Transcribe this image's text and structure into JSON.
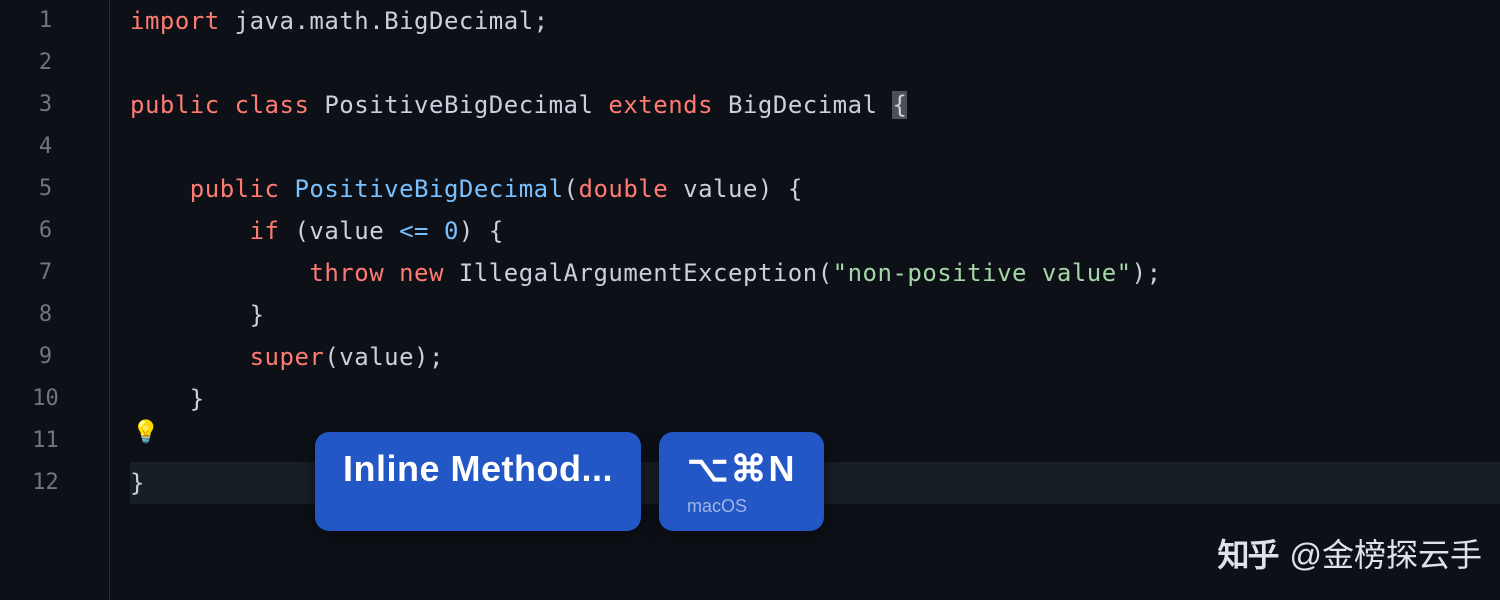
{
  "gutter": {
    "lines": [
      "1",
      "2",
      "3",
      "4",
      "5",
      "6",
      "7",
      "8",
      "9",
      "10",
      "11",
      "12"
    ]
  },
  "code": {
    "l1": {
      "kw_import": "import",
      "pkg": "java.math.BigDecimal",
      "semi": ";"
    },
    "l3": {
      "kw_public": "public",
      "kw_class": "class",
      "name": "PositiveBigDecimal",
      "kw_extends": "extends",
      "supertype": "BigDecimal",
      "brace": "{"
    },
    "l5": {
      "kw_public": "public",
      "ctor": "PositiveBigDecimal",
      "lp": "(",
      "ptype": "double",
      "pname": "value",
      "rp": ")",
      "brace": "{"
    },
    "l6": {
      "kw_if": "if",
      "lp": "(",
      "var": "value",
      "op": "<=",
      "zero": "0",
      "rp": ")",
      "brace": "{"
    },
    "l7": {
      "kw_throw": "throw",
      "kw_new": "new",
      "ex": "IllegalArgumentException",
      "lp": "(",
      "str": "\"non-positive value\"",
      "rp": ")",
      "semi": ";"
    },
    "l8": {
      "brace": "}"
    },
    "l9": {
      "kw_super": "super",
      "lp": "(",
      "var": "value",
      "rp": ")",
      "semi": ";"
    },
    "l10": {
      "brace": "}"
    },
    "l12": {
      "brace": "}"
    }
  },
  "hint": {
    "bulb": "💡"
  },
  "popup": {
    "action": "Inline Method...",
    "shortcut": "⌥⌘N",
    "platform": "macOS"
  },
  "watermark": {
    "logo": "知乎",
    "at": "@金榜探云手"
  }
}
